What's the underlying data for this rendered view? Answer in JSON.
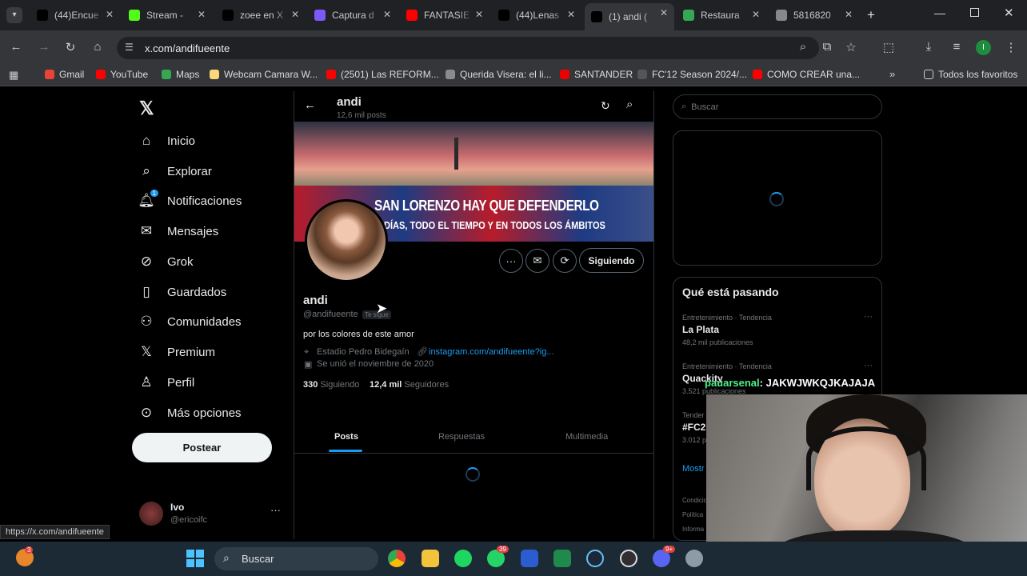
{
  "browser": {
    "tabs": [
      {
        "label": "(44)Encue",
        "color": "#000000",
        "icon": "tiktok-icon"
      },
      {
        "label": "Stream -",
        "color": "#53fc18",
        "icon": "kick-icon"
      },
      {
        "label": "zoee en X",
        "color": "#000000",
        "icon": "x-icon"
      },
      {
        "label": "Captura d",
        "color": "#7a5af8",
        "icon": "capture-icon"
      },
      {
        "label": "FANTASIE",
        "color": "#ff0000",
        "icon": "youtube-icon"
      },
      {
        "label": "(44)Lenas",
        "color": "#000000",
        "icon": "tiktok-icon"
      },
      {
        "label": "(1) andi (",
        "color": "#000000",
        "icon": "x-icon"
      },
      {
        "label": "Restaura",
        "color": "#34a853",
        "icon": "restore-icon"
      },
      {
        "label": "5816820",
        "color": "#888888",
        "icon": "globe-icon"
      }
    ],
    "url": "x.com/andifueente",
    "bookmarks": [
      {
        "label": "Gmail",
        "color": "#ea4335"
      },
      {
        "label": "YouTube",
        "color": "#ff0000"
      },
      {
        "label": "Maps",
        "color": "#34a853"
      },
      {
        "label": "Webcam Camara W...",
        "color": "#f9d976"
      },
      {
        "label": "(2501) Las REFORM...",
        "color": "#ff0000"
      },
      {
        "label": "Querida Visera: el li...",
        "color": "#8a8a8a"
      },
      {
        "label": "SANTANDER",
        "color": "#ec0000"
      },
      {
        "label": "FC'12 Season 2024/...",
        "color": "#555555"
      },
      {
        "label": "COMO CREAR una...",
        "color": "#ff0000"
      }
    ],
    "all_favorites": "Todos los favoritos",
    "status_url": "https://x.com/andifueente"
  },
  "sidebar": {
    "items": [
      {
        "label": "Inicio",
        "icon": "home-icon"
      },
      {
        "label": "Explorar",
        "icon": "search-icon"
      },
      {
        "label": "Notificaciones",
        "icon": "bell-icon",
        "badge": "1"
      },
      {
        "label": "Mensajes",
        "icon": "mail-icon"
      },
      {
        "label": "Grok",
        "icon": "grok-icon"
      },
      {
        "label": "Guardados",
        "icon": "bookmark-icon"
      },
      {
        "label": "Comunidades",
        "icon": "communities-icon"
      },
      {
        "label": "Premium",
        "icon": "x-premium-icon"
      },
      {
        "label": "Perfil",
        "icon": "person-icon"
      },
      {
        "label": "Más opciones",
        "icon": "more-circle-icon"
      }
    ],
    "post_button": "Postear",
    "account": {
      "name": "Ivo",
      "handle": "@ericoifc"
    }
  },
  "profile": {
    "header_name": "andi",
    "header_posts": "12,6 mil posts",
    "banner_text_1": "SAN LORENZO HAY QUE DEFENDERLO",
    "banner_text_2": "DÍAS, TODO EL TIEMPO Y EN TODOS LOS ÁMBITOS",
    "name": "andi",
    "handle": "@andifueente",
    "follows_you": "Te sigue",
    "bio": "por los colores de este amor",
    "location": "Estadio Pedro Bidegaín",
    "link": "instagram.com/andifueente?ig...",
    "joined": "Se unió el noviembre de 2020",
    "following_count": "330",
    "following_label": "Siguiendo",
    "followers_count": "12,4 mil",
    "followers_label": "Seguidores",
    "follow_button": "Siguiendo",
    "tabs": [
      "Posts",
      "Respuestas",
      "Multimedia"
    ]
  },
  "right": {
    "search_placeholder": "Buscar",
    "trends_title": "Qué está pasando",
    "trends": [
      {
        "meta": "Entretenimiento · Tendencia",
        "name": "La Plata",
        "count": "48,2 mil publicaciones"
      },
      {
        "meta": "Entretenimiento · Tendencia",
        "name": "Quackity",
        "count": "3.521 publicaciones"
      },
      {
        "meta": "Tender",
        "name": "#FC2",
        "count": "3.012 p"
      }
    ],
    "show_more": "Mostr",
    "footer": [
      "Condicio",
      "Política",
      "Informa"
    ]
  },
  "stream": {
    "chat_user": "pauarsenal",
    "chat_message": ": JAKWJWKQJKAJAJA",
    "chat_user_color": "#4ef08a"
  },
  "taskbar": {
    "search": "Buscar",
    "badges": {
      "whatsapp": "39",
      "discord": "9+",
      "hamster": "3"
    }
  }
}
